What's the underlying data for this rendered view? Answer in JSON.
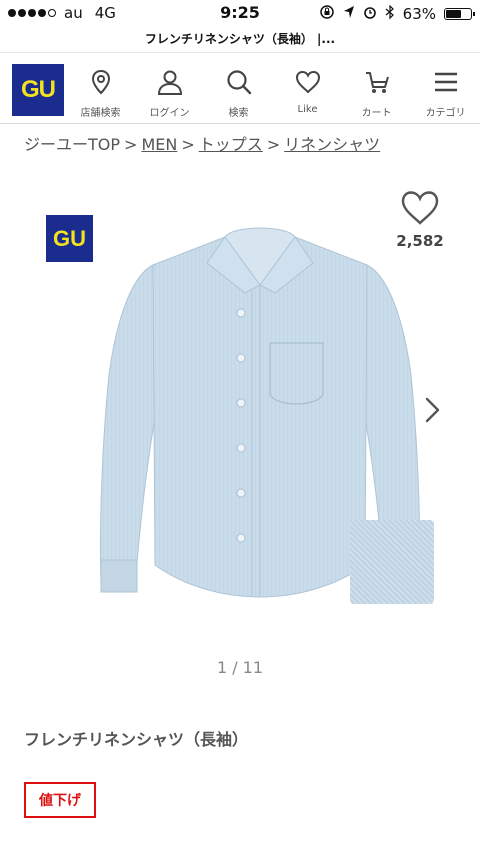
{
  "status_bar": {
    "carrier": "au",
    "network": "4G",
    "time": "9:25",
    "battery_percent": "63%",
    "battery_level": 0.63
  },
  "url_bar": {
    "title": "フレンチリネンシャツ（長袖） |..."
  },
  "header": {
    "logo": "GU",
    "nav": [
      {
        "label": "店舗検索",
        "icon": "location-pin-icon"
      },
      {
        "label": "ログイン",
        "icon": "user-icon"
      },
      {
        "label": "検索",
        "icon": "search-icon"
      },
      {
        "label": "Like",
        "icon": "heart-icon"
      },
      {
        "label": "カート",
        "icon": "cart-icon"
      },
      {
        "label": "カテゴリ",
        "icon": "menu-icon"
      }
    ]
  },
  "breadcrumb": {
    "items": [
      "ジーユーTOP",
      "MEN",
      "トップス",
      "リネンシャツ"
    ],
    "separator": ">"
  },
  "product": {
    "brand_badge": "GU",
    "like_count": "2,582",
    "pager": "1 / 11",
    "name": "フレンチリネンシャツ（長袖）",
    "price_badge": "値下げ",
    "accent_color": "#dd1111",
    "brand_color": "#1a2d8f"
  }
}
